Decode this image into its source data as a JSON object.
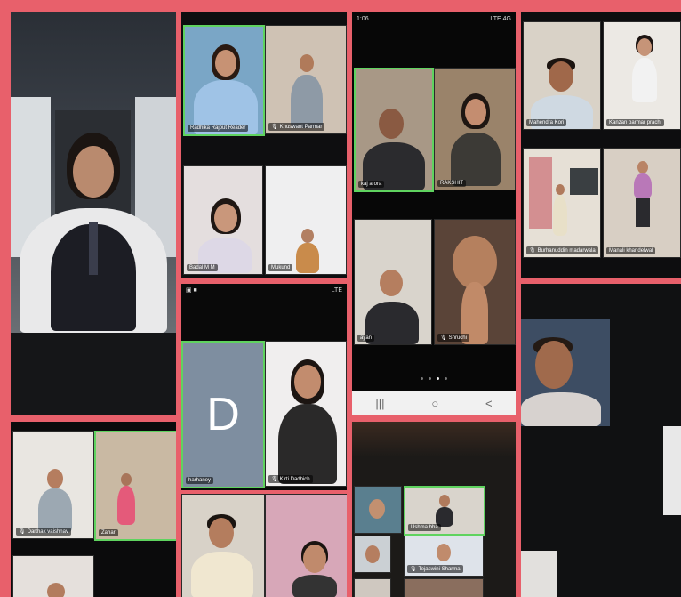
{
  "frame_color": "#e8606b",
  "panel_a": {},
  "panel_b": {
    "tiles": [
      {
        "name": "Radhika Rajput Reader",
        "active": true
      },
      {
        "name": "Khuswant Parmar",
        "mic": "mic-icon"
      },
      {
        "name": "Badal M M"
      },
      {
        "name": "Mukund"
      }
    ]
  },
  "panel_c": {
    "status_time": "1:06",
    "status_right": "LTE 4G",
    "tiles": [
      {
        "name": "kaj arora"
      },
      {
        "name": "RAKSHIT"
      },
      {
        "name": "ayan"
      },
      {
        "name": "Shruchi",
        "mic": "mic-icon"
      }
    ],
    "nav": [
      "|||",
      "○",
      "<"
    ]
  },
  "panel_d": {
    "tiles": [
      {
        "name": "Mahendra Kori"
      },
      {
        "name": "Kanzan parmar prachi"
      },
      {
        "name": "Burhanuddin madarwala",
        "mic": "mic-icon"
      },
      {
        "name": "Manali khandelwal"
      }
    ]
  },
  "panel_e": {
    "status_right": "LTE",
    "d_letter": "D",
    "tiles": [
      {
        "name": "harhaney"
      },
      {
        "name": "Kirti Dadhich",
        "mic": "mic-icon"
      }
    ]
  },
  "panel_f": {
    "tiles": [
      {
        "name": "Darthak vaishnav",
        "mic": "mic-icon"
      },
      {
        "name": "Zahar"
      }
    ]
  },
  "panel_g": {
    "tiles": [
      {
        "name": "Ushma bha"
      },
      {
        "name": "Tejaswini Sharma",
        "mic": "mic-icon"
      }
    ]
  },
  "panel_h": {}
}
